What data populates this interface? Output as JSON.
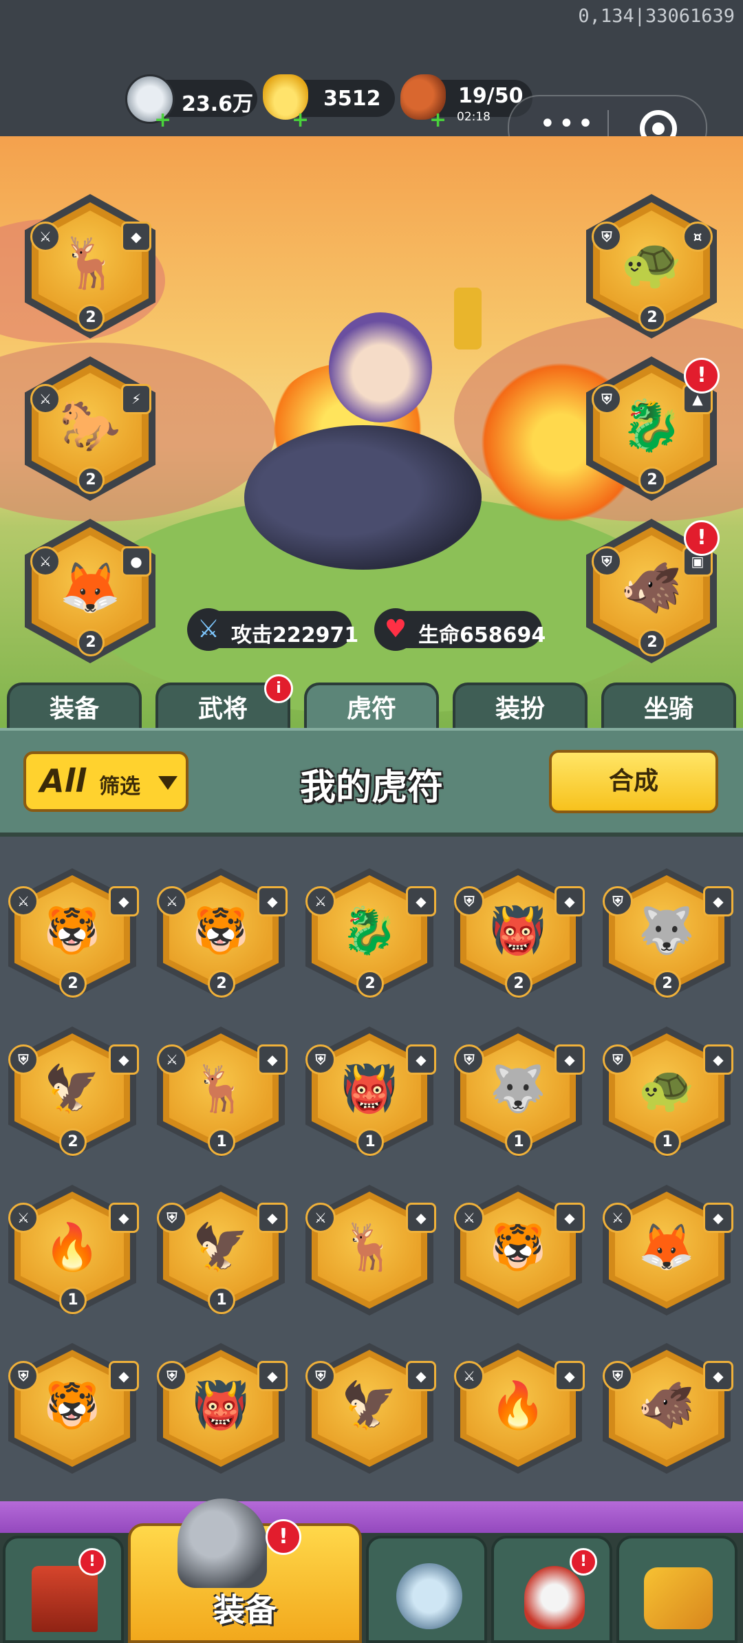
{
  "debug": "0,134|33061639",
  "resources": {
    "silver": "23.6万",
    "gold": "3512",
    "stamina": "19/50",
    "stamina_timer": "02:18"
  },
  "hero_stats": {
    "attack": "攻击222971",
    "health": "生命658694"
  },
  "equipped_slots": {
    "left": [
      {
        "level": "2",
        "attack": true
      },
      {
        "level": "2",
        "attack": true
      },
      {
        "level": "2",
        "attack": true
      }
    ],
    "right": [
      {
        "level": "2",
        "attack": false,
        "alert": false
      },
      {
        "level": "2",
        "attack": false,
        "alert": true
      },
      {
        "level": "2",
        "attack": false,
        "alert": true
      }
    ]
  },
  "alert_mark": "!",
  "tabs": [
    {
      "label": "装备",
      "active": false,
      "badge": false
    },
    {
      "label": "武将",
      "active": false,
      "badge": true
    },
    {
      "label": "虎符",
      "active": true,
      "badge": false
    },
    {
      "label": "装扮",
      "active": false,
      "badge": false
    },
    {
      "label": "坐骑",
      "active": false,
      "badge": false
    }
  ],
  "tab_badge_mark": "i",
  "panel": {
    "filter_all": "All",
    "filter_label": "筛选",
    "title": "我的虎符",
    "merge_label": "合成"
  },
  "inventory": [
    {
      "level": "2",
      "attack": true,
      "creature": "tiger"
    },
    {
      "level": "2",
      "attack": true,
      "creature": "tiger"
    },
    {
      "level": "2",
      "attack": true,
      "creature": "dragon"
    },
    {
      "level": "2",
      "attack": false,
      "creature": "mask"
    },
    {
      "level": "2",
      "attack": false,
      "creature": "wolf"
    },
    {
      "level": "2",
      "attack": false,
      "creature": "phoenix"
    },
    {
      "level": "1",
      "attack": true,
      "creature": "deer"
    },
    {
      "level": "1",
      "attack": false,
      "creature": "mask"
    },
    {
      "level": "1",
      "attack": false,
      "creature": "wolf"
    },
    {
      "level": "1",
      "attack": false,
      "creature": "turtle"
    },
    {
      "level": "1",
      "attack": true,
      "creature": "flame"
    },
    {
      "level": "1",
      "attack": false,
      "creature": "phoenix"
    },
    {
      "level": "",
      "attack": true,
      "creature": "deer"
    },
    {
      "level": "",
      "attack": true,
      "creature": "tiger"
    },
    {
      "level": "",
      "attack": true,
      "creature": "fox"
    },
    {
      "level": "",
      "attack": false,
      "creature": "tiger"
    },
    {
      "level": "",
      "attack": false,
      "creature": "mask"
    },
    {
      "level": "",
      "attack": false,
      "creature": "phoenix"
    },
    {
      "level": "",
      "attack": true,
      "creature": "flame"
    },
    {
      "level": "",
      "attack": false,
      "creature": "boar"
    }
  ],
  "bottom_nav": {
    "active_label": "装备",
    "alert_mark": "!"
  },
  "colors": {
    "accent_gold": "#f0a92a",
    "panel_green": "#5c8578",
    "alert_red": "#e21d2d"
  }
}
